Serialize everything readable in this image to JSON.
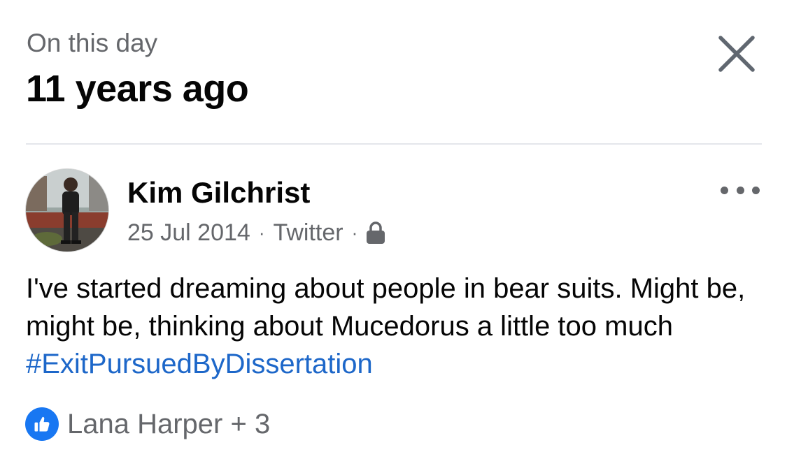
{
  "header": {
    "kicker": "On this day",
    "title": "11 years ago",
    "close_icon": "close-icon"
  },
  "post": {
    "author": "Kim Gilchrist",
    "date": "25 Jul 2014",
    "source": "Twitter",
    "separator": "·",
    "privacy_icon": "lock-icon",
    "more_icon": "more-horizontal-icon",
    "text": "I've started dreaming about people in bear suits. Might be, might be, thinking about Mucedorus a little too much",
    "hashtag": "#ExitPursuedByDissertation",
    "hashtag_color": "#1d67c9"
  },
  "reactions": {
    "icon": "like-icon",
    "text": "Lana Harper + 3",
    "like_color": "#1877f2"
  }
}
